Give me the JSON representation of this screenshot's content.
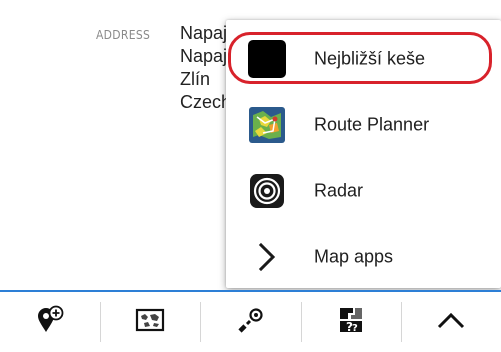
{
  "detail": {
    "address_label": "ADDRESS",
    "address_lines": [
      "Napajedla",
      "Napajedla",
      "Zlín",
      "Czechia"
    ]
  },
  "menu": {
    "items": [
      {
        "label": "Nejbližší keše",
        "icon": "black-square-icon",
        "highlighted": true
      },
      {
        "label": "Route Planner",
        "icon": "route-planner-app-icon"
      },
      {
        "label": "Radar",
        "icon": "radar-icon"
      },
      {
        "label": "Map apps",
        "icon": "chevron-right-icon"
      }
    ]
  },
  "toolbar": {
    "buttons": [
      {
        "icon": "add-waypoint-icon"
      },
      {
        "icon": "map-icon"
      },
      {
        "icon": "navigate-to-target-icon"
      },
      {
        "icon": "unknown-cache-icon"
      },
      {
        "icon": "chevron-up-icon"
      }
    ]
  },
  "colors": {
    "toolbar_accent": "#2d7fd6",
    "highlight_ring": "#d8222b"
  }
}
